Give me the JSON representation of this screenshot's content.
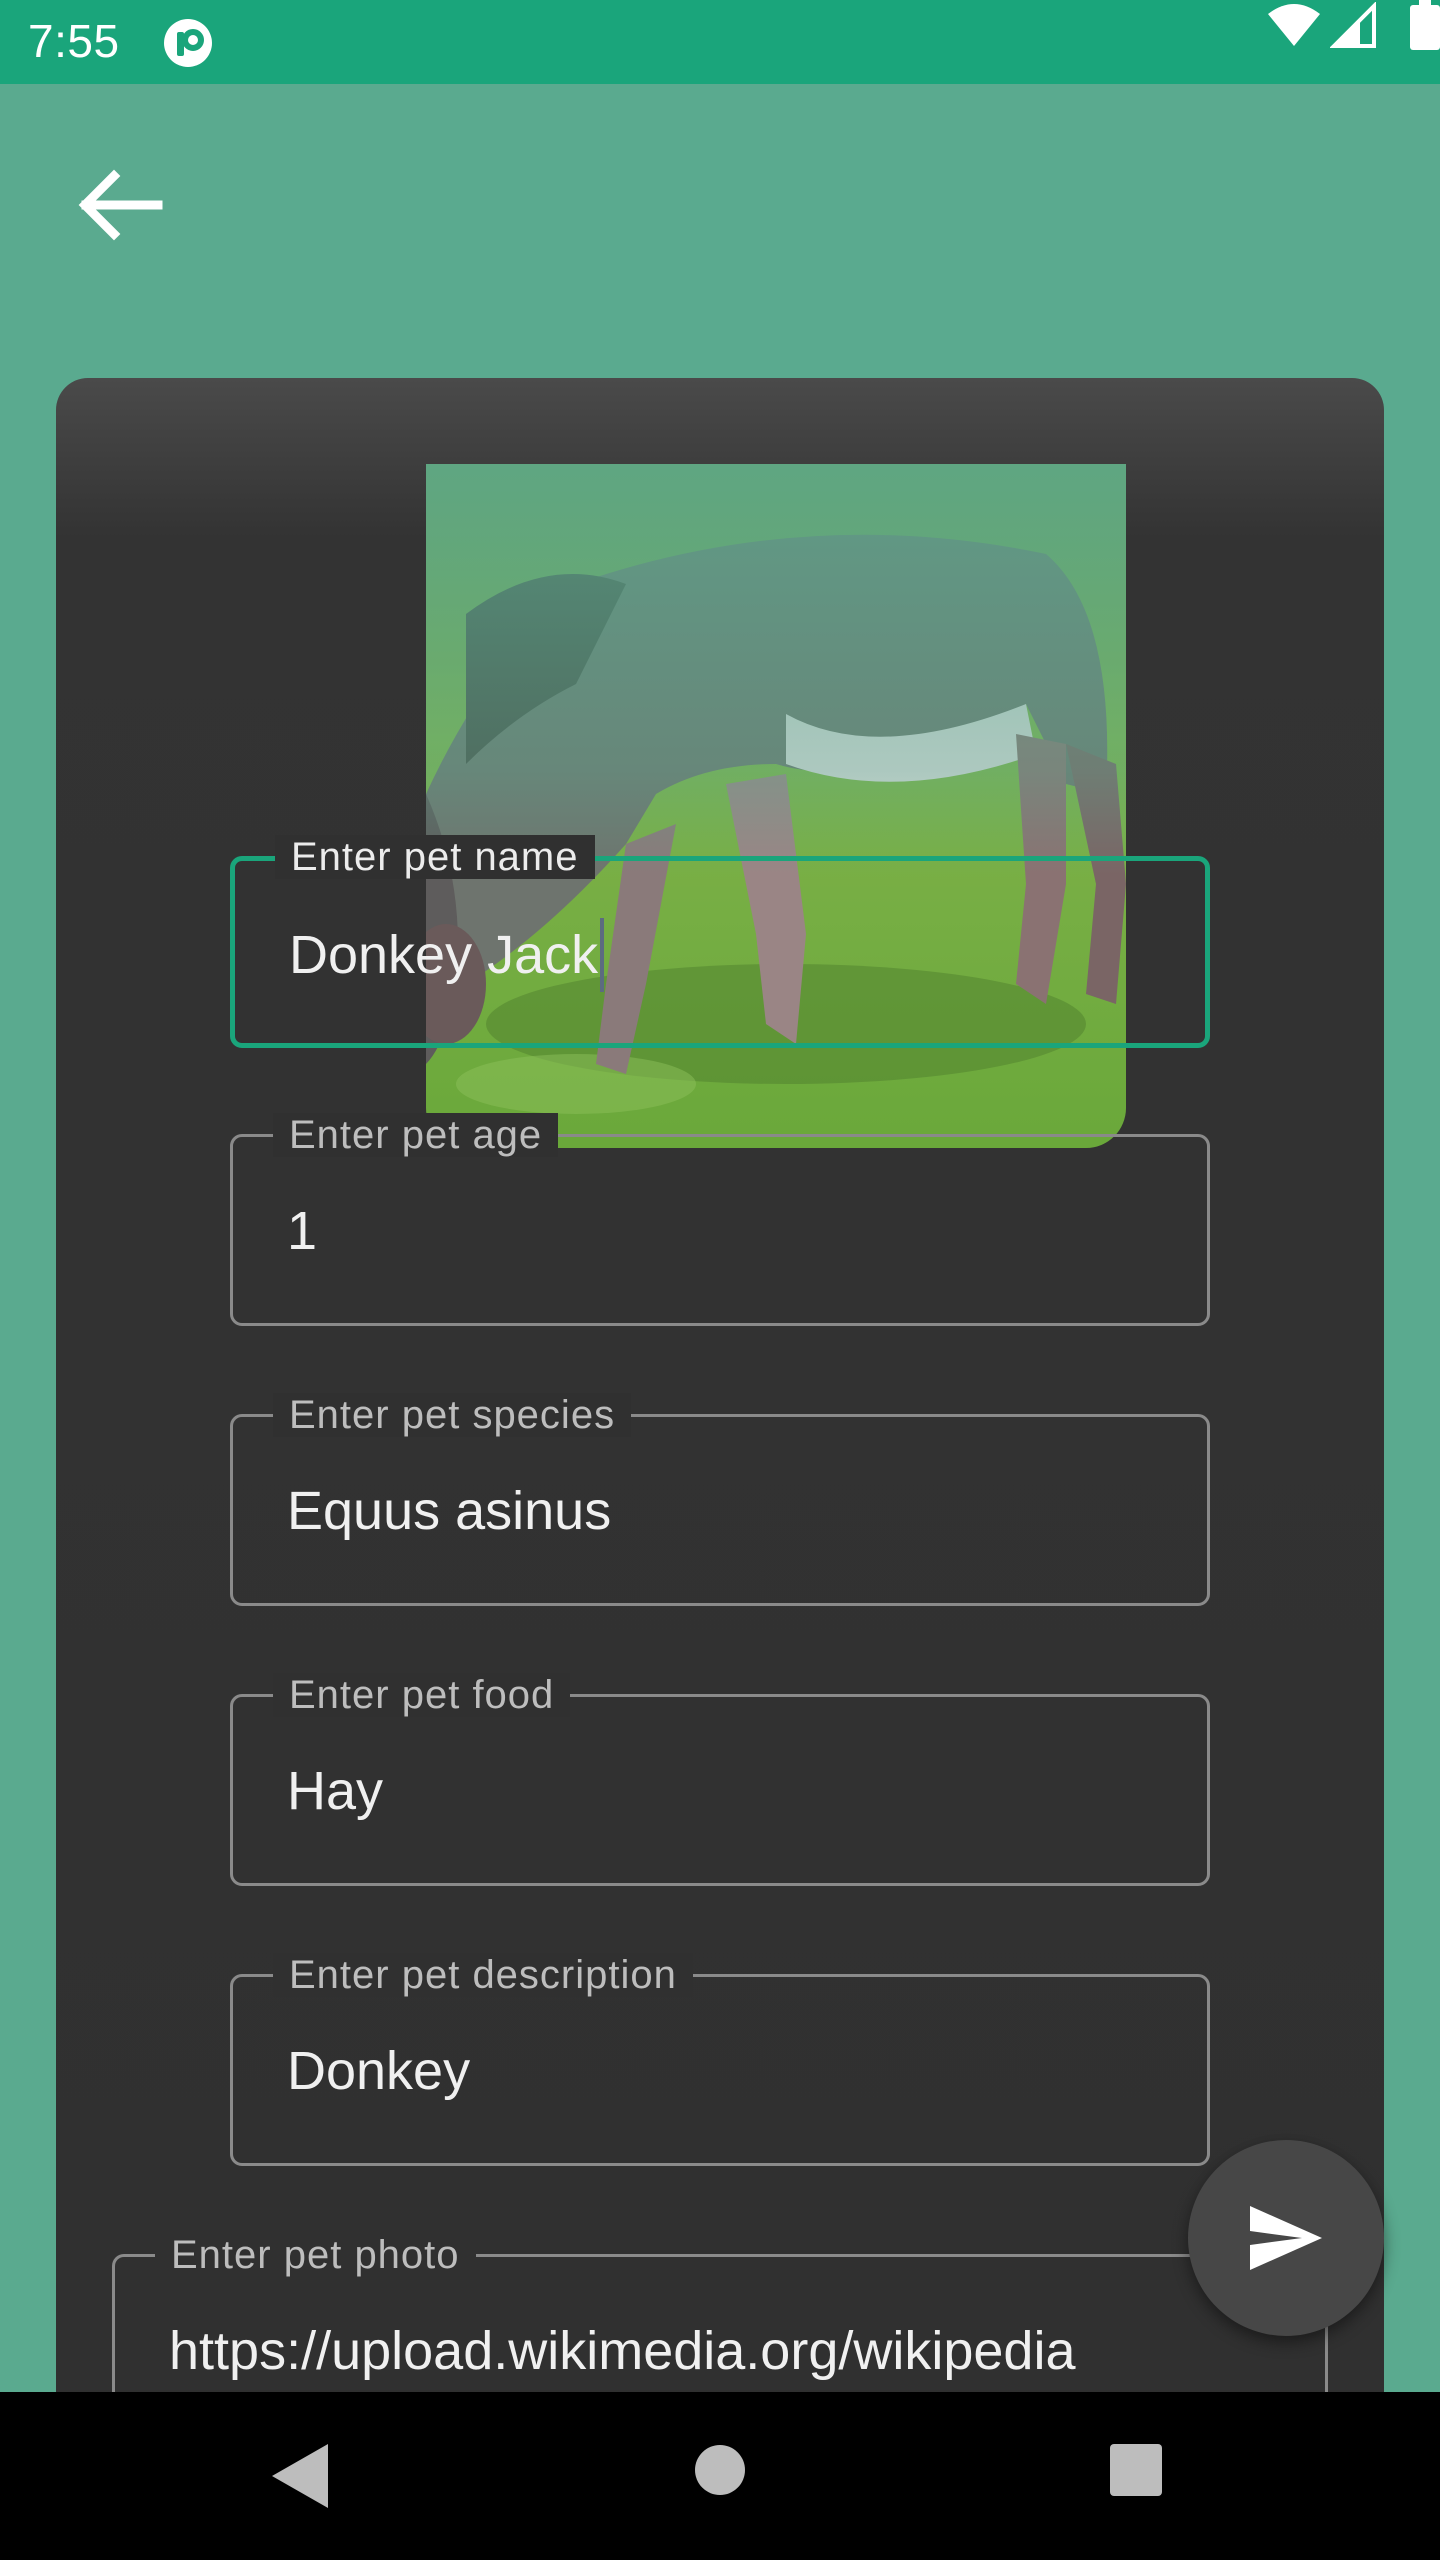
{
  "status_bar": {
    "time": "7:55",
    "icons": [
      "app-notification-icon",
      "wifi-icon",
      "signal-icon",
      "battery-icon"
    ]
  },
  "header": {
    "back_icon": "arrow-left-icon"
  },
  "pet_image": {
    "subject": "donkey grazing on grass"
  },
  "form": {
    "name": {
      "label": "Enter pet name",
      "value": "Donkey Jack"
    },
    "age": {
      "label": "Enter pet age",
      "value": "1"
    },
    "species": {
      "label": "Enter pet species",
      "value": "Equus asinus"
    },
    "food": {
      "label": "Enter pet food",
      "value": "Hay"
    },
    "description": {
      "label": "Enter pet description",
      "value": "Donkey"
    },
    "photo": {
      "label": "Enter pet photo",
      "value": "https://upload.wikimedia.org/wikipedia"
    }
  },
  "fab": {
    "icon": "send-icon"
  },
  "nav_bar": {
    "icons": [
      "nav-back-icon",
      "nav-home-icon",
      "nav-recents-icon"
    ]
  },
  "colors": {
    "status_bar": "#1aa57b",
    "background": "#5aaa8f",
    "card": "#303030",
    "accent": "#1aa57b"
  }
}
